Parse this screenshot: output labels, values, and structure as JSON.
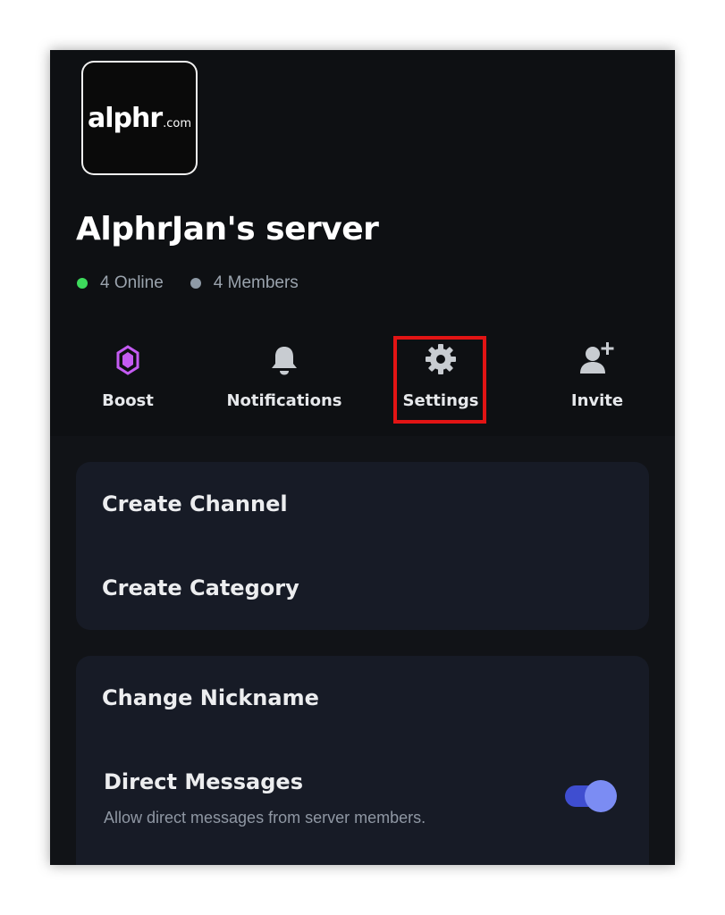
{
  "server": {
    "logo_text": "alphr",
    "logo_suffix": ".com",
    "name": "AlphrJan's server",
    "online_text": "4 Online",
    "members_text": "4 Members"
  },
  "actions": {
    "boost": "Boost",
    "notifications": "Notifications",
    "settings": "Settings",
    "invite": "Invite"
  },
  "menu1": {
    "create_channel": "Create Channel",
    "create_category": "Create Category"
  },
  "menu2": {
    "change_nickname": "Change Nickname",
    "direct_messages": "Direct Messages",
    "direct_messages_desc": "Allow direct messages from server members.",
    "direct_messages_enabled": true
  },
  "colors": {
    "online": "#3ba55d",
    "members": "#8e9aa6",
    "boost": "#c45bf2",
    "highlight": "#e21414",
    "toggle": "#7b8cf3"
  },
  "icons": {
    "boost": "boost-gem-icon",
    "notifications": "bell-icon",
    "settings": "gear-icon",
    "invite": "add-person-icon"
  }
}
